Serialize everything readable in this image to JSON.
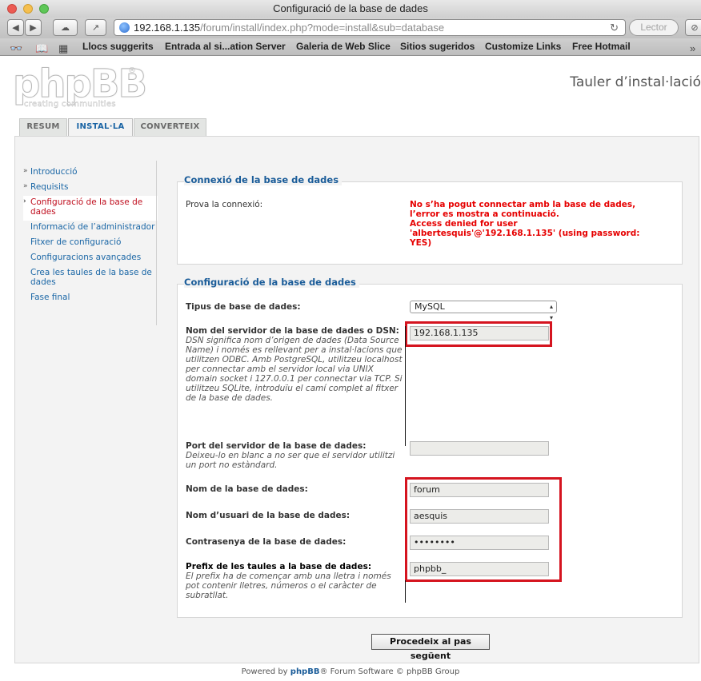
{
  "browser": {
    "window_title": "Configuració de la base de dades",
    "url_host": "192.168.1.135",
    "url_path": "/forum/install/index.php?mode=install&sub=database",
    "reader_label": "Lector",
    "bookmarks": [
      "Llocs suggerits",
      "Entrada al si...ation Server",
      "Galeria de Web Slice",
      "Sitios sugeridos",
      "Customize Links",
      "Free Hotmail"
    ]
  },
  "header": {
    "logo_text": "phpBB",
    "logo_tagline": "creating communities",
    "site_title": "Tauler d’instal·lació"
  },
  "tabs": [
    {
      "label": "RESUM"
    },
    {
      "label": "INSTAL·LA"
    },
    {
      "label": "CONVERTEIX"
    }
  ],
  "menu": [
    {
      "label": "Introducció"
    },
    {
      "label": "Requisits"
    },
    {
      "label": "Configuració de la base de dades"
    },
    {
      "label": "Informació de l’administrador"
    },
    {
      "label": "Fitxer de configuració"
    },
    {
      "label": "Configuracions avançades"
    },
    {
      "label": "Crea les taules de la base de dades"
    },
    {
      "label": "Fase final"
    }
  ],
  "connection": {
    "legend": "Connexió de la base de dades",
    "label": "Prova la connexió:",
    "error_line1": "No s’ha pogut connectar amb la base de dades, l’error es mostra a continuació.",
    "error_line2": "Access denied for user 'albertesquis'@'192.168.1.135' (using password: YES)"
  },
  "config": {
    "legend": "Configuració de la base de dades",
    "db_type_label": "Tipus de base de dades:",
    "db_type_value": "MySQL",
    "server_label": "Nom del servidor de la base de dades o DSN:",
    "server_help": "DSN significa nom d’origen de dades (Data Source Name) i només es rellevant per a instal·lacions que utilitzen ODBC. Amb PostgreSQL, utilitzeu localhost per connectar amb el servidor local via UNIX domain socket i 127.0.0.1 per connectar via TCP. Si utilitzeu SQLite, introduïu el camí complet al fitxer de la base de dades.",
    "server_value": "192.168.1.135",
    "port_label": "Port del servidor de la base de dades:",
    "port_help": "Deixeu-lo en blanc a no ser que el servidor utilitzi un port no estàndard.",
    "port_value": "",
    "dbname_label": "Nom de la base de dades:",
    "dbname_value": "forum",
    "user_label": "Nom d’usuari de la base de dades:",
    "user_value": "aesquis",
    "password_label": "Contrasenya de la base de dades:",
    "password_value": "••••••••",
    "prefix_label": "Prefix de les taules a la base de dades:",
    "prefix_help": "El prefix ha de començar amb una lletra i només pot contenir lletres, números o el caràcter de subratllat.",
    "prefix_value": "phpbb_"
  },
  "submit_label": "Procedeix al pas següent",
  "footer": {
    "prefix": "Powered by ",
    "brand": "phpBB",
    "suffix": "® Forum Software © phpBB Group"
  }
}
